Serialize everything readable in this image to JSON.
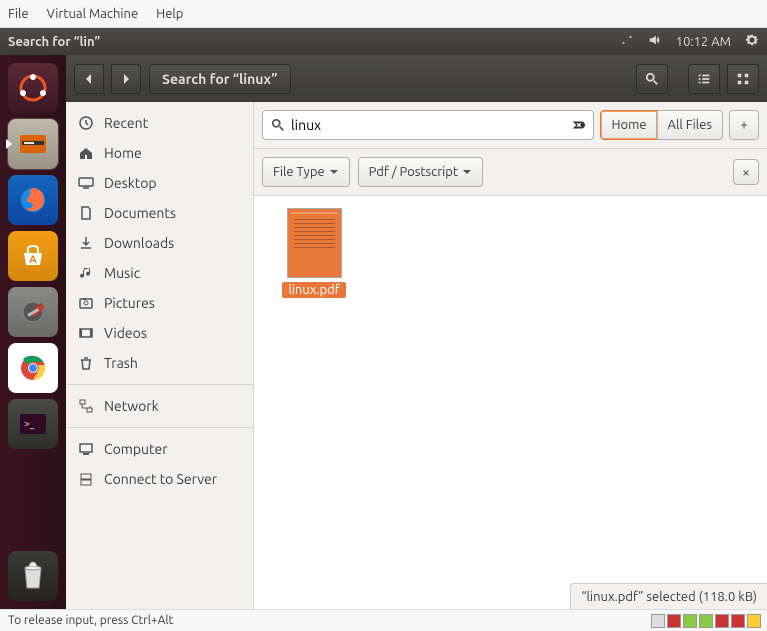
{
  "vm_menu": {
    "file": "File",
    "virtual_machine": "Virtual Machine",
    "help": "Help"
  },
  "panel": {
    "title": "Search for “lin”",
    "time": "10:12 AM"
  },
  "toolbar": {
    "location": "Search for “linux”"
  },
  "sidebar": {
    "recent": "Recent",
    "home": "Home",
    "desktop": "Desktop",
    "documents": "Documents",
    "downloads": "Downloads",
    "music": "Music",
    "pictures": "Pictures",
    "videos": "Videos",
    "trash": "Trash",
    "network": "Network",
    "computer": "Computer",
    "connect": "Connect to Server"
  },
  "search": {
    "query": "linux",
    "home_btn": "Home",
    "allfiles_btn": "All Files"
  },
  "filters": {
    "filetype": "File Type",
    "pdf": "Pdf / Postscript"
  },
  "files": {
    "item0": {
      "name": "linux.pdf"
    }
  },
  "status": {
    "text": "“linux.pdf” selected  (118.0 kB)"
  },
  "bottom": {
    "hint": "To release input, press Ctrl+Alt"
  }
}
